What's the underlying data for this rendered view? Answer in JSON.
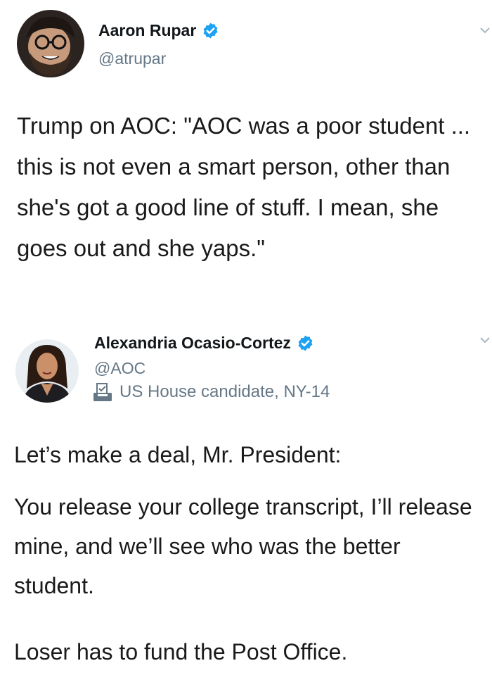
{
  "tweets": [
    {
      "author": {
        "display_name": "Aaron Rupar",
        "handle": "@atrupar",
        "verified": true,
        "avatar_icon": "avatar-bearded-man-glasses"
      },
      "text": "Trump on AOC: \"AOC was a poor student ... this is not even a smart person, other than she's got a good line of stuff. I mean, she goes out and she yaps.\""
    },
    {
      "author": {
        "display_name": "Alexandria Ocasio-Cortez",
        "handle": "@AOC",
        "verified": true,
        "bio_label": "US House candidate, NY-14",
        "bio_icon": "ballot-box-icon",
        "avatar_icon": "avatar-woman-portrait"
      },
      "paragraphs": [
        "Let’s make a deal, Mr. President:",
        "You release your college transcript, I’ll release mine, and we’ll see who was the better student.",
        "Loser has to fund the Post Office."
      ]
    }
  ],
  "colors": {
    "verified_badge": "#1da1f2",
    "secondary_text": "#657786",
    "primary_text": "#14171a",
    "background": "#ffffff"
  }
}
